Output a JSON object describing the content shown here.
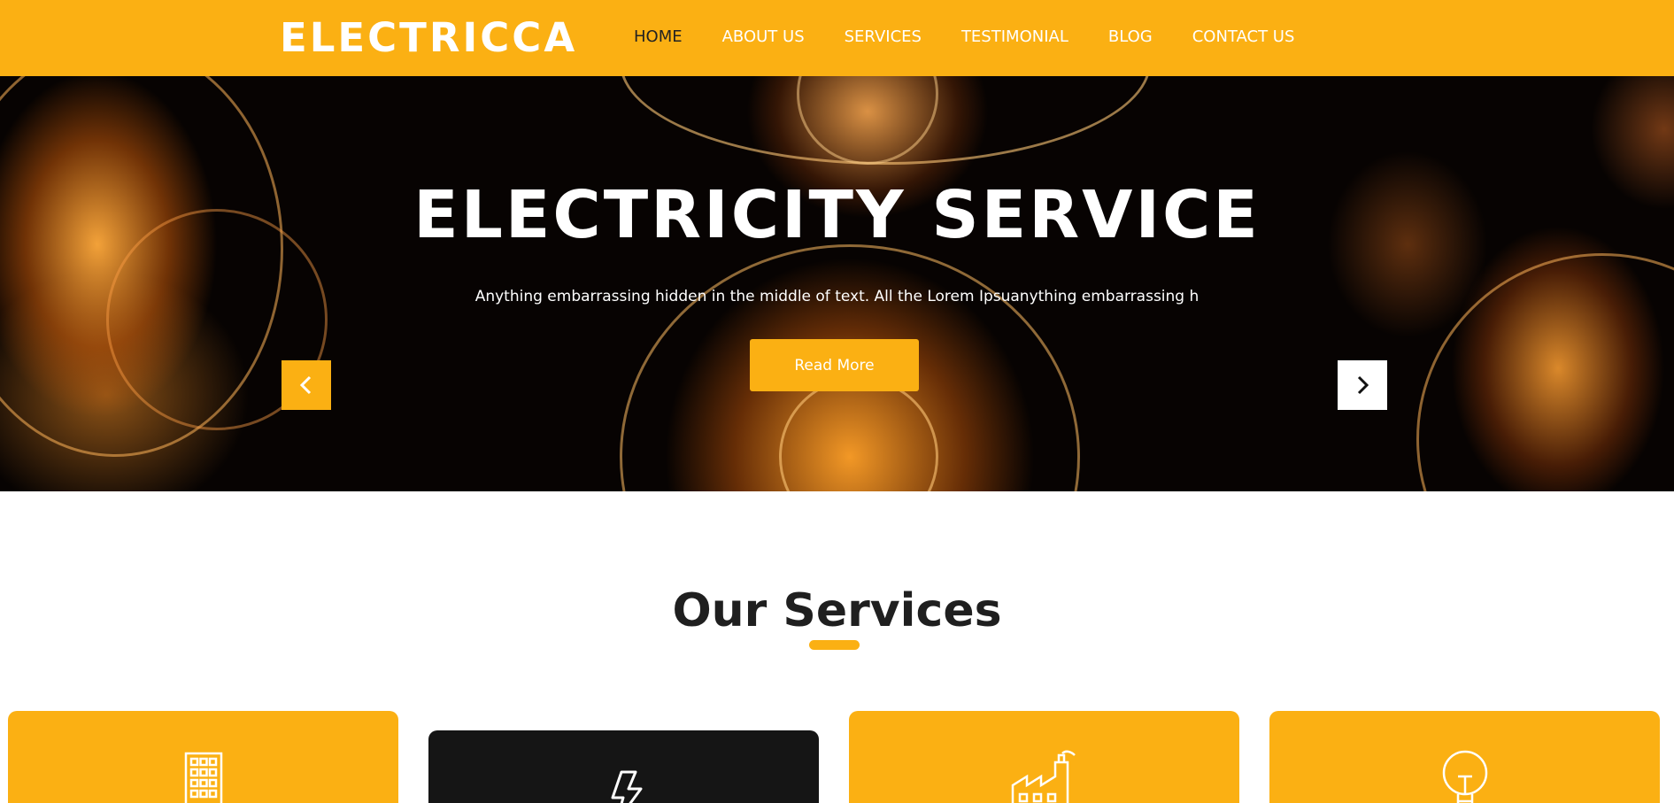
{
  "header": {
    "logo": "ELECTRICCA",
    "nav": [
      {
        "label": "HOME",
        "active": true
      },
      {
        "label": "ABOUT US",
        "active": false
      },
      {
        "label": "SERVICES",
        "active": false
      },
      {
        "label": "TESTIMONIAL",
        "active": false
      },
      {
        "label": "BLOG",
        "active": false
      },
      {
        "label": "CONTACT US",
        "active": false
      }
    ]
  },
  "hero": {
    "title": "ELECTRICITY SERVICE",
    "subtitle": "Anything embarrassing hidden in the middle of text. All the Lorem Ipsuanything embarrassing h",
    "button_label": "Read More",
    "prev_icon": "chevron-left-icon",
    "next_icon": "chevron-right-icon"
  },
  "services": {
    "title": "Our Services",
    "cards": [
      {
        "icon": "building-icon",
        "style": "yellow"
      },
      {
        "icon": "lightning-icon",
        "style": "dark"
      },
      {
        "icon": "factory-icon",
        "style": "yellow"
      },
      {
        "icon": "lightbulb-icon",
        "style": "yellow"
      }
    ]
  },
  "colors": {
    "accent": "#fbb013",
    "dark": "#151515",
    "text": "#1f1f1f",
    "white": "#ffffff"
  }
}
